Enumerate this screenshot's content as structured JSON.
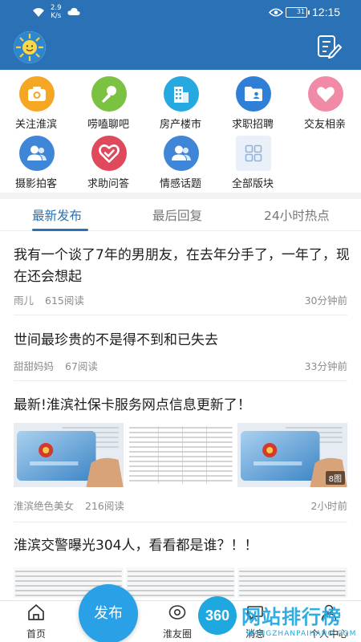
{
  "status_bar": {
    "network_speed": "2.9\nK/s",
    "battery": "31",
    "time": "12:15"
  },
  "colors": {
    "brand_blue": "#2a72b5",
    "publish_blue": "#2aa0e6",
    "tab_active": "#2a72b5"
  },
  "categories": [
    {
      "label": "关注淮滨",
      "icon": "camera-icon",
      "color": "#f5a623"
    },
    {
      "label": "唠嗑聊吧",
      "icon": "microphone-icon",
      "color": "#7cc242"
    },
    {
      "label": "房产楼市",
      "icon": "building-icon",
      "color": "#25a9e0"
    },
    {
      "label": "求职招聘",
      "icon": "id-folder-icon",
      "color": "#2f7fd6"
    },
    {
      "label": "交友相亲",
      "icon": "heart-icon",
      "color": "#f08aa6"
    },
    {
      "label": "摄影拍客",
      "icon": "users-icon",
      "color": "#3f86d8"
    },
    {
      "label": "求助问答",
      "icon": "heart-check-icon",
      "color": "#e0485b"
    },
    {
      "label": "情感话题",
      "icon": "users-icon",
      "color": "#3f86d8"
    },
    {
      "label": "全部版块",
      "icon": "grid-icon",
      "color": "#e9f0f8"
    }
  ],
  "tabs": [
    {
      "label": "最新发布",
      "active": true
    },
    {
      "label": "最后回复",
      "active": false
    },
    {
      "label": "24小时热点",
      "active": false
    }
  ],
  "posts": [
    {
      "title": "我有一个谈了7年的男朋友，在去年分手了，一年了，现在还会想起",
      "author": "雨儿",
      "reads": "615阅读",
      "time": "30分钟前"
    },
    {
      "title": "世间最珍贵的不是得不到和已失去",
      "author": "甜甜妈妈",
      "reads": "67阅读",
      "time": "33分钟前"
    },
    {
      "title": "最新!淮滨社保卡服务网点信息更新了！",
      "author": "淮滨绝色美女",
      "reads": "216阅读",
      "time": "2小时前",
      "image_count": "8图",
      "card_caption_1": "中华人民共和国",
      "card_caption_2": "社会保障卡"
    },
    {
      "title": "淮滨交警曝光304人，看看都是谁？！！"
    }
  ],
  "bottom_nav": {
    "home": "首页",
    "publish": "发布",
    "circle": "淮友圈",
    "message": "消息",
    "profile": "个人中心"
  },
  "watermark": {
    "logo_text": "360",
    "text": "网站排行榜",
    "sub": "WANGZHANPAIHANG.COM"
  }
}
